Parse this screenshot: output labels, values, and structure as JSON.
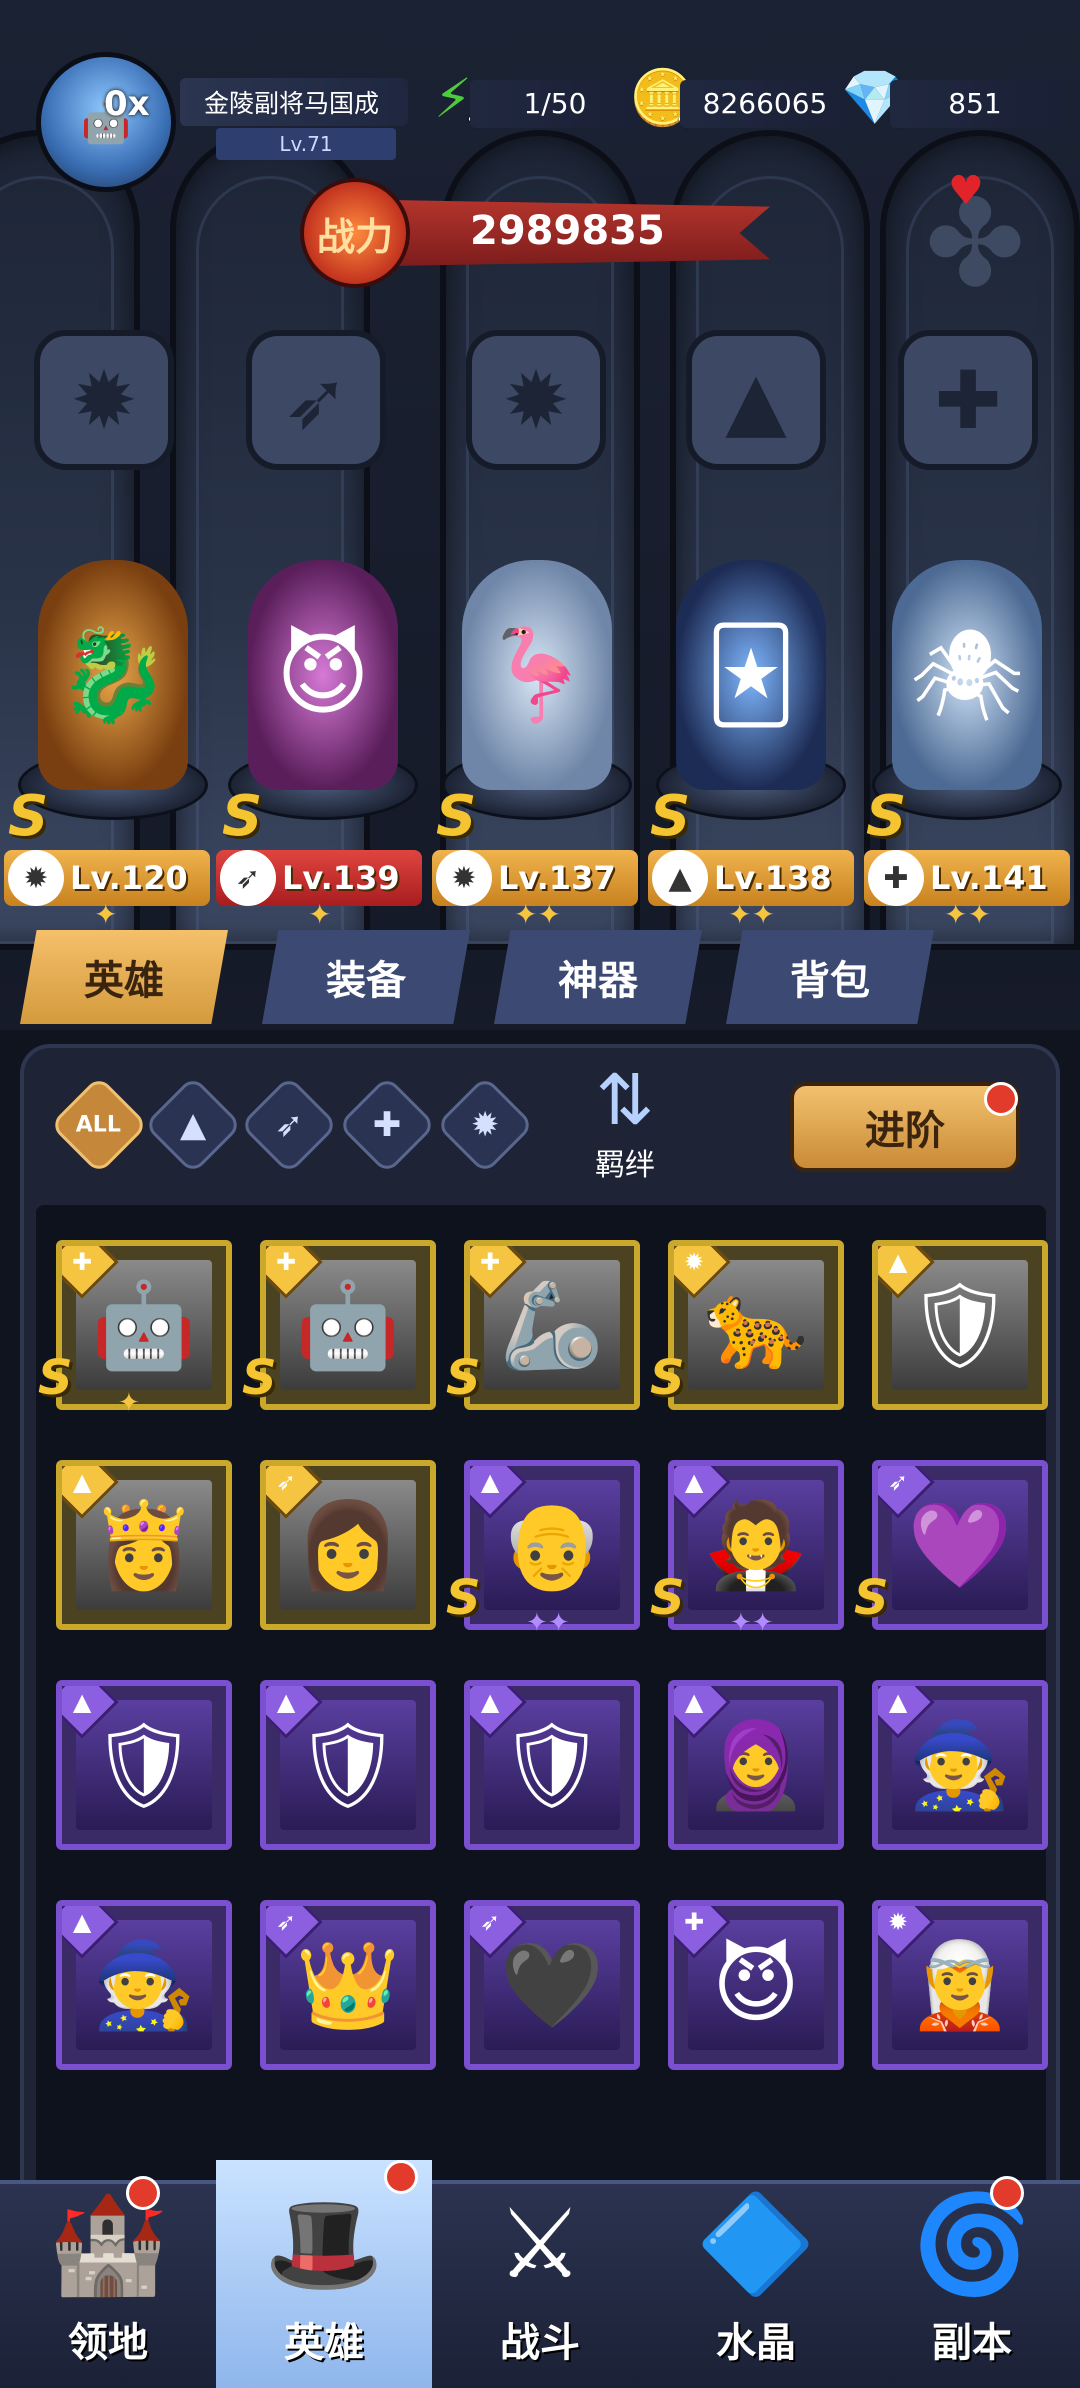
{
  "player": {
    "vip": "0",
    "name": "金陵副将马国成",
    "level": "Lv.71"
  },
  "resources": {
    "energy": "1/50",
    "gold": "8266065",
    "gems": "851"
  },
  "power": {
    "label": "战力",
    "value": "2989835"
  },
  "heroes": [
    {
      "rank": "S",
      "level": "Lv.120",
      "faction_icon": "beast-icon",
      "stars": "✦"
    },
    {
      "rank": "S",
      "level": "Lv.139",
      "faction_icon": "wing-icon",
      "stars": "✦",
      "highlight": "red"
    },
    {
      "rank": "S",
      "level": "Lv.137",
      "faction_icon": "beast-icon",
      "stars": "✦✦"
    },
    {
      "rank": "S",
      "level": "Lv.138",
      "faction_icon": "wizard-hat-icon",
      "stars": "✦✦"
    },
    {
      "rank": "S",
      "level": "Lv.141",
      "faction_icon": "wrench-icon",
      "stars": "✦✦"
    }
  ],
  "tabs": [
    "英雄",
    "装备",
    "神器",
    "背包"
  ],
  "filters": {
    "all": "ALL",
    "bond": "羁绊"
  },
  "advance": "进阶",
  "cards": [
    {
      "rarity": "gold",
      "cls": "wrench-icon",
      "rank": "S",
      "stars": "✦"
    },
    {
      "rarity": "gold",
      "cls": "wrench-icon",
      "rank": "S",
      "stars": ""
    },
    {
      "rarity": "gold",
      "cls": "wrench-icon",
      "rank": "S",
      "stars": ""
    },
    {
      "rarity": "gold",
      "cls": "beast-icon",
      "rank": "S",
      "stars": ""
    },
    {
      "rarity": "gold",
      "cls": "wizard-hat-icon",
      "rank": "",
      "stars": ""
    },
    {
      "rarity": "gold",
      "cls": "wizard-hat-icon",
      "rank": "",
      "stars": ""
    },
    {
      "rarity": "gold",
      "cls": "wing-icon",
      "rank": "",
      "stars": ""
    },
    {
      "rarity": "purple",
      "cls": "wizard-hat-icon",
      "rank": "S",
      "stars": "✦✦"
    },
    {
      "rarity": "purple",
      "cls": "wizard-hat-icon",
      "rank": "S",
      "stars": "✦✦"
    },
    {
      "rarity": "purple",
      "cls": "wing-icon",
      "rank": "S",
      "stars": ""
    },
    {
      "rarity": "purple",
      "cls": "wizard-hat-icon",
      "rank": "",
      "stars": ""
    },
    {
      "rarity": "purple",
      "cls": "wizard-hat-icon",
      "rank": "",
      "stars": ""
    },
    {
      "rarity": "purple",
      "cls": "wizard-hat-icon",
      "rank": "",
      "stars": ""
    },
    {
      "rarity": "purple",
      "cls": "wizard-hat-icon",
      "rank": "",
      "stars": ""
    },
    {
      "rarity": "purple",
      "cls": "wizard-hat-icon",
      "rank": "",
      "stars": ""
    },
    {
      "rarity": "purple",
      "cls": "wizard-hat-icon",
      "rank": "",
      "stars": ""
    },
    {
      "rarity": "purple",
      "cls": "wing-icon",
      "rank": "",
      "stars": ""
    },
    {
      "rarity": "purple",
      "cls": "wing-icon",
      "rank": "",
      "stars": ""
    },
    {
      "rarity": "purple",
      "cls": "wrench-icon",
      "rank": "",
      "stars": ""
    },
    {
      "rarity": "purple",
      "cls": "beast-icon",
      "rank": "",
      "stars": ""
    }
  ],
  "nav": [
    "领地",
    "英雄",
    "战斗",
    "水晶",
    "副本"
  ],
  "colors": {
    "gold": "#f5c542",
    "purple": "#7a4fd0",
    "tab_active": "#d49a3d",
    "badge": "#e23b2b"
  }
}
